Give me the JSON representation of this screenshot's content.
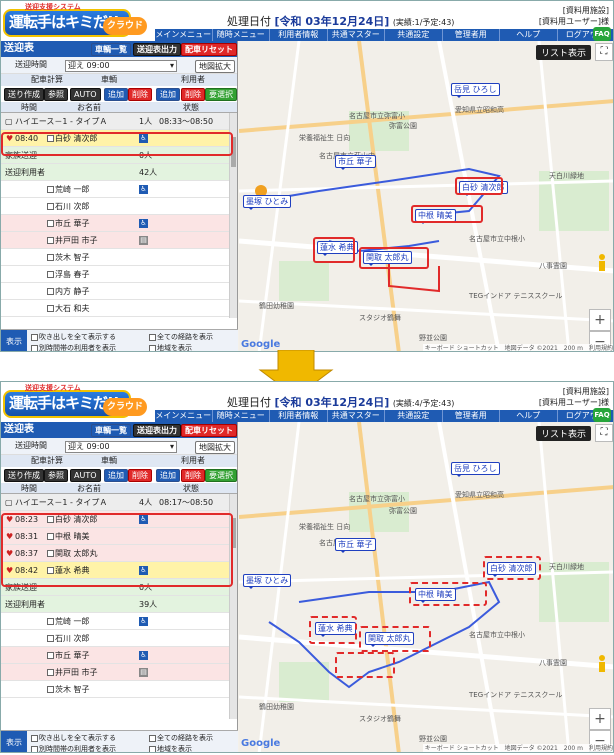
{
  "header": {
    "logo_small": "送迎支援システム",
    "logo_main": "運転手はキミ",
    "logo_tag": "だ!!",
    "logo_cloud": "クラウド",
    "proc_label": "処理日付",
    "proc_date": "[令和 03年12月24日]",
    "facility_line1": "[資料用施設]",
    "facility_line2": "[資料用ユーザー]様",
    "faq": "FAQ",
    "menu": [
      "メインメニュー",
      "随時メニュー",
      "利用者情報",
      "共通マスター",
      "共通設定",
      "管理者用",
      "ヘルプ",
      "ログアウト"
    ]
  },
  "screens": [
    {
      "proc_count": "(実績:1/予定:43)",
      "panel_title": "送迎表",
      "btn_vehicle_list": "車輌一覧",
      "btn_output": "送迎表出力",
      "btn_reset": "配車リセット",
      "time_label": "送迎時間",
      "time_value": "迎え 09:00",
      "map_zoom_label": "地図拡大",
      "calc_label": "配車計算",
      "vehicle_label": "車輌",
      "user_label": "利用者",
      "btn_create": "送り作成",
      "btn_ref": "参照",
      "btn_auto": "AUTO",
      "btn_add": "追加",
      "btn_delete": "削除",
      "btn_add2": "追加",
      "btn_delete2": "削除",
      "btn_select": "要選択",
      "col_time": "時間",
      "col_name": "お名前",
      "col_state": "状態",
      "vehicle": {
        "name": "ハイエース－1 - タイプＡ",
        "count": "1人",
        "range": "08:33～08:50"
      },
      "stops": [
        {
          "time": "08:40",
          "name": "白砂 清次郎",
          "icon": "wc"
        }
      ],
      "family_label": "家族送迎",
      "family_count": "0人",
      "users_label": "送迎利用者",
      "users_count": "42人",
      "users": [
        {
          "name": "荒崎 一郎",
          "icon": "wc"
        },
        {
          "name": "石川 次郎",
          "icon": ""
        },
        {
          "name": "市丘 華子",
          "icon": "wc"
        },
        {
          "name": "井戸田 市子",
          "icon": "bed"
        },
        {
          "name": "茨木 智子",
          "icon": ""
        },
        {
          "name": "浮島 春子",
          "icon": ""
        },
        {
          "name": "内方 静子",
          "icon": ""
        },
        {
          "name": "大石 和夫",
          "icon": ""
        }
      ],
      "foot_disp": "表示",
      "foot_opt1": "吹き出しを全て表示する",
      "foot_opt2": "全ての経路を表示",
      "foot_opt3": "別時間帯の利用者を表示",
      "foot_opt4": "地域を表示",
      "list_btn": "リスト表示"
    },
    {
      "proc_count": "(実績:4/予定:43)",
      "panel_title": "送迎表",
      "btn_vehicle_list": "車輌一覧",
      "btn_output": "送迎表出力",
      "btn_reset": "配車リセット",
      "time_label": "送迎時間",
      "time_value": "迎え 09:00",
      "map_zoom_label": "地図拡大",
      "calc_label": "配車計算",
      "vehicle_label": "車輌",
      "user_label": "利用者",
      "btn_create": "送り作成",
      "btn_ref": "参照",
      "btn_auto": "AUTO",
      "btn_add": "追加",
      "btn_delete": "削除",
      "btn_add2": "追加",
      "btn_delete2": "削除",
      "btn_select": "要選択",
      "col_time": "時間",
      "col_name": "お名前",
      "col_state": "状態",
      "vehicle": {
        "name": "ハイエース－1 - タイプＡ",
        "count": "4人",
        "range": "08:17～08:50"
      },
      "stops": [
        {
          "time": "08:23",
          "name": "白砂 清次郎",
          "icon": "wc"
        },
        {
          "time": "08:31",
          "name": "中根 晴美",
          "icon": ""
        },
        {
          "time": "08:37",
          "name": "関取 太郎丸",
          "icon": ""
        },
        {
          "time": "08:42",
          "name": "蓮水 希典",
          "icon": "wc"
        }
      ],
      "family_label": "家族送迎",
      "family_count": "0人",
      "users_label": "送迎利用者",
      "users_count": "39人",
      "users": [
        {
          "name": "荒崎 一郎",
          "icon": "wc"
        },
        {
          "name": "石川 次郎",
          "icon": ""
        },
        {
          "name": "市丘 華子",
          "icon": "wc"
        },
        {
          "name": "井戸田 市子",
          "icon": "bed"
        },
        {
          "name": "茨木 智子",
          "icon": ""
        }
      ],
      "foot_disp": "表示",
      "foot_opt1": "吹き出しを全て表示する",
      "foot_opt2": "全ての経路を表示",
      "foot_opt3": "別時間帯の利用者を表示",
      "foot_opt4": "地域を表示",
      "list_btn": "リスト表示"
    }
  ],
  "map": {
    "pins": {
      "takaoka": "岳見 ひろし",
      "ichioka": "市丘 華子",
      "shirasuna": "白砂 清次郎",
      "nakane": "中根 晴美",
      "sumizome": "墨塚 ひとみ",
      "hasumi": "蓮水 希典",
      "sekitori": "関取 太郎丸"
    },
    "labels": [
      "名古屋市立弥富小",
      "愛知県立昭和高",
      "名古屋市立萩山中",
      "弥富公園",
      "天白川緑地",
      "杁中駅",
      "鶴田幼稚園",
      "スタジオ鶴舞",
      "TEGインドア テニススクール",
      "福生寺",
      "野並公園",
      "八事霊園",
      "名古屋市立中根小",
      "瑞穂運動場東",
      "栄養福祉生 日向"
    ],
    "google": "Google",
    "attr": "キーボード ショートカット　地図データ ©2021　200 m　利用規約"
  },
  "colors": {
    "accent": "#1f5bb3",
    "alert": "#e12a2a",
    "highlight": "#fff3a8",
    "arrow": "#f0b800"
  }
}
